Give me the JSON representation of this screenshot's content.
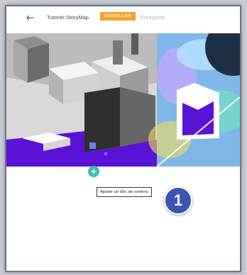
{
  "header": {
    "title": "Tutoriel StoryMap",
    "status_badge": "BROUILLON",
    "save_state": "Enregistré",
    "back_icon": "arrow-left-icon"
  },
  "hero": {
    "description_icon": "cover-image"
  },
  "builder": {
    "add_icon": "plus-icon",
    "tooltip": "Ajouter un bloc de contenu"
  },
  "annotation": {
    "step_number": "1"
  },
  "colors": {
    "badge": "#f4a428",
    "add_button": "#3fbcb1",
    "step_badge": "#3a55b0",
    "purple": "#5a12d6"
  }
}
